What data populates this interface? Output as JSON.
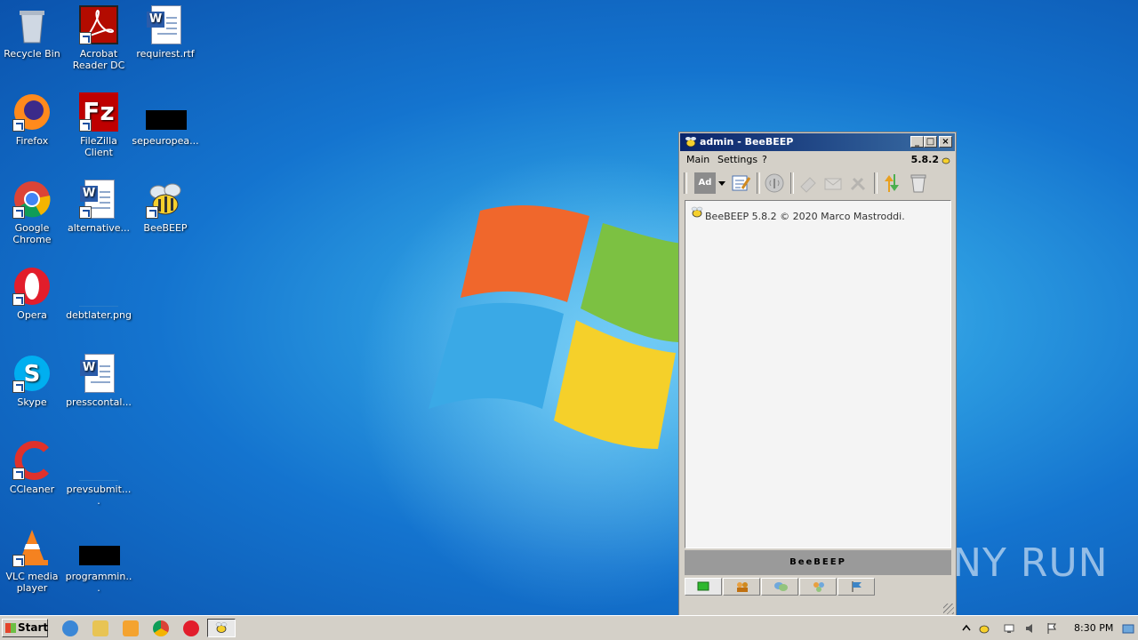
{
  "desktop_icons": [
    {
      "label": "Recycle Bin"
    },
    {
      "label": "Acrobat Reader DC"
    },
    {
      "label": "requirest.rtf"
    },
    {
      "label": "Firefox"
    },
    {
      "label": "FileZilla Client"
    },
    {
      "label": "sepeuropea..."
    },
    {
      "label": "Google Chrome"
    },
    {
      "label": "alternative..."
    },
    {
      "label": "BeeBEEP"
    },
    {
      "label": "Opera"
    },
    {
      "label": "debtlater.png"
    },
    {
      "label": "Skype"
    },
    {
      "label": "presscontal..."
    },
    {
      "label": "CCleaner"
    },
    {
      "label": "prevsubmit...."
    },
    {
      "label": "VLC media player"
    },
    {
      "label": "programmin..."
    }
  ],
  "window": {
    "title": "admin - BeeBEEP",
    "menu": [
      "Main",
      "Settings",
      "?"
    ],
    "version": "5.8.2",
    "toolbar_ad_label": "Ad",
    "chat_line": "BeeBEEP 5.8.2 © 2020 Marco Mastroddi.",
    "bottom_banner": "BeeBEEP"
  },
  "taskbar": {
    "start_label": "Start",
    "clock": "8:30 PM"
  },
  "watermark": "ANY RUN",
  "colors": {
    "titlebar_start": "#0a246a",
    "titlebar_end": "#3a6ea5",
    "desktop_blue": "#1474cf"
  }
}
